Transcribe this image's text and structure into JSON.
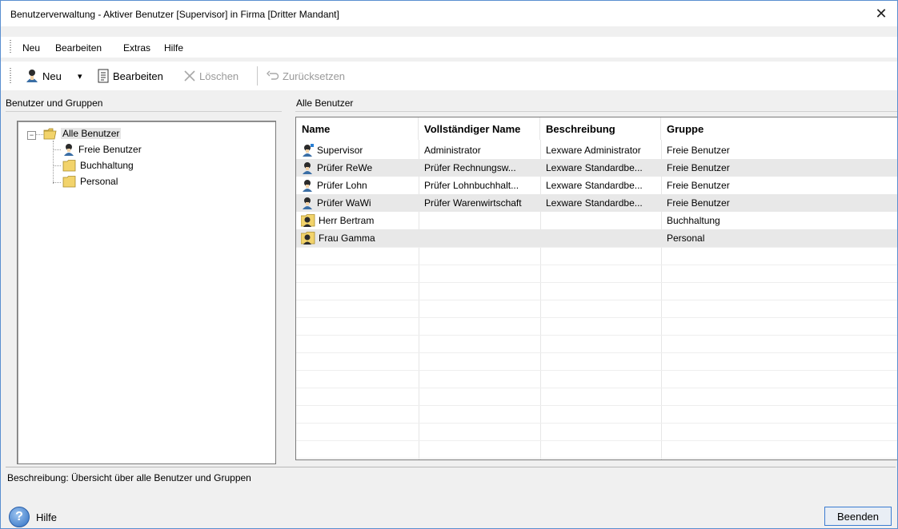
{
  "window": {
    "title": "Benutzerverwaltung - Aktiver Benutzer [Supervisor] in Firma [Dritter Mandant]",
    "close_glyph": "✕"
  },
  "menu": {
    "items": [
      {
        "label": "Neu"
      },
      {
        "label": "Bearbeiten"
      },
      {
        "label": "Extras"
      },
      {
        "label": "Hilfe"
      }
    ]
  },
  "toolbar": {
    "new_label": "Neu",
    "new_dropdown_glyph": "▾",
    "edit_label": "Bearbeiten",
    "delete_label": "Löschen",
    "reset_label": "Zurücksetzen"
  },
  "left_pane": {
    "title": "Benutzer und Gruppen",
    "tree": {
      "root": "Alle Benutzer",
      "children": [
        "Freie Benutzer",
        "Buchhaltung",
        "Personal"
      ]
    }
  },
  "right_pane": {
    "title": "Alle Benutzer",
    "columns": [
      "Name",
      "Vollständiger Name",
      "Beschreibung",
      "Gruppe"
    ],
    "rows": [
      {
        "name": "Supervisor",
        "full_name": "Administrator",
        "description": "Lexware Administrator",
        "group": "Freie Benutzer",
        "icon": "admin-user-icon"
      },
      {
        "name": "Prüfer ReWe",
        "full_name": "Prüfer Rechnungsw...",
        "description": "Lexware Standardbe...",
        "group": "Freie Benutzer",
        "icon": "user-icon"
      },
      {
        "name": "Prüfer Lohn",
        "full_name": "Prüfer Lohnbuchhalt...",
        "description": "Lexware Standardbe...",
        "group": "Freie Benutzer",
        "icon": "user-icon"
      },
      {
        "name": "Prüfer WaWi",
        "full_name": "Prüfer Warenwirtschaft",
        "description": "Lexware Standardbe...",
        "group": "Freie Benutzer",
        "icon": "user-icon"
      },
      {
        "name": "Herr Bertram",
        "full_name": "",
        "description": "",
        "group": "Buchhaltung",
        "icon": "group-user-icon"
      },
      {
        "name": "Frau Gamma",
        "full_name": "",
        "description": "",
        "group": "Personal",
        "icon": "group-user-icon"
      }
    ]
  },
  "description_bar": {
    "text": "Beschreibung: Übersicht über alle Benutzer und Gruppen"
  },
  "footer": {
    "help_label": "Hilfe",
    "help_glyph": "?",
    "end_label": "Beenden"
  },
  "colors": {
    "accent": "#3b7bd1",
    "selected_row": "#e8e8e8",
    "folder": "#f2d36b"
  }
}
